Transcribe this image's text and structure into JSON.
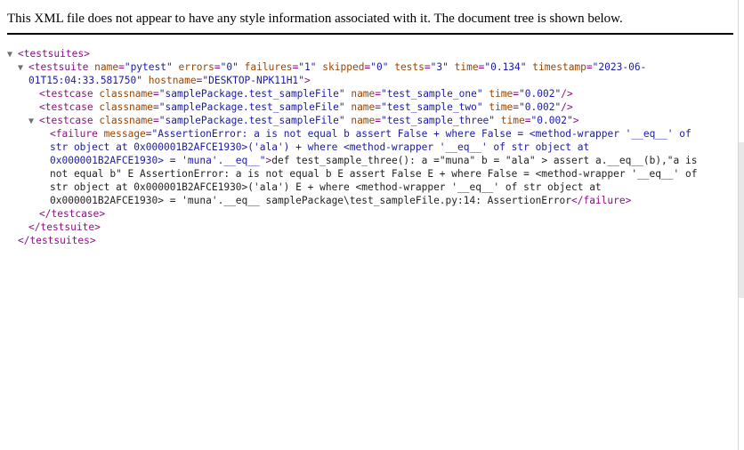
{
  "banner": "This XML file does not appear to have any style information associated with it. The document tree is shown below.",
  "toggles": {
    "expanded": "▼"
  },
  "testsuites": {
    "open": "<testsuites>",
    "close": "</testsuites>"
  },
  "testsuite": {
    "open_prefix": "<testsuite",
    "name": "pytest",
    "errors": "0",
    "failures": "1",
    "skipped": "0",
    "tests": "3",
    "time": "0.134",
    "timestamp": "2023-06-01T15:04:33.581750",
    "timestamp_part1": "2023-06-",
    "timestamp_part2": "01T15:04:33.581750",
    "hostname": "DESKTOP-NPK11H1",
    "close": "</testsuite>"
  },
  "testcases": [
    {
      "classname": "samplePackage.test_sampleFile",
      "name": "test_sample_one",
      "time": "0.002"
    },
    {
      "classname": "samplePackage.test_sampleFile",
      "name": "test_sample_two",
      "time": "0.002"
    },
    {
      "classname": "samplePackage.test_sampleFile",
      "name": "test_sample_three",
      "time": "0.002"
    }
  ],
  "testcase_close": "</testcase>",
  "failure": {
    "message_lines": [
      "AssertionError: a is not equal b assert False + where False = <method-wrapper '__eq__' of",
      "str object at 0x000001B2AFCE1930>('ala') + where <method-wrapper '__eq__' of str object at",
      "0x000001B2AFCE1930> = 'muna'.__eq__"
    ],
    "text_lines": [
      "def test_sample_three(): a =\"muna\" b = \"ala\" > assert a.__eq__(b),\"a is",
      "not equal b\" E AssertionError: a is not equal b E assert False E + where False = <method-wrapper '__eq__' of",
      "str object at 0x000001B2AFCE1930>('ala') E + where <method-wrapper '__eq__' of str object at",
      "0x000001B2AFCE1930> = 'muna'.__eq__ samplePackage\\test_sampleFile.py:14: AssertionError"
    ],
    "close": "</failure>"
  }
}
